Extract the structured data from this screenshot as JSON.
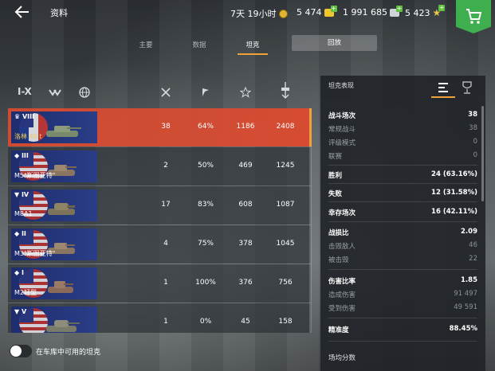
{
  "header": {
    "title": "资料",
    "premium_time": "7天 19小时",
    "gold": "5 474",
    "credits": "1 991 685",
    "free_xp": "5 423"
  },
  "tabs": [
    {
      "label": "主要",
      "active": false
    },
    {
      "label": "数据",
      "active": false
    },
    {
      "label": "坦克",
      "active": true
    },
    {
      "label": "回放",
      "active": false
    }
  ],
  "filters": {
    "tier_filter": "I-X",
    "type_icon": "tank-type-filter-icon",
    "nation_icon": "globe-icon"
  },
  "columns": [
    "battles-icon",
    "winrate-icon",
    "mastery-icon",
    "sort-icon"
  ],
  "tanks": [
    {
      "tier": "VIII",
      "name": "洛林 40 t",
      "premium": true,
      "battles": "38",
      "win": "64%",
      "xp": "1186",
      "dmg": "2408"
    },
    {
      "tier": "III",
      "name": "M5\"斯图亚特\"",
      "premium": false,
      "battles": "2",
      "win": "50%",
      "xp": "469",
      "dmg": "1245"
    },
    {
      "tier": "IV",
      "name": "M8A1",
      "premium": false,
      "battles": "17",
      "win": "83%",
      "xp": "608",
      "dmg": "1087"
    },
    {
      "tier": "II",
      "name": "M3\"斯图亚特\"",
      "premium": false,
      "battles": "4",
      "win": "75%",
      "xp": "378",
      "dmg": "1045"
    },
    {
      "tier": "I",
      "name": "M2轻型",
      "premium": false,
      "battles": "1",
      "win": "100%",
      "xp": "376",
      "dmg": "756"
    },
    {
      "tier": "V",
      "name": "",
      "premium": false,
      "battles": "1",
      "win": "0%",
      "xp": "45",
      "dmg": "158"
    }
  ],
  "toggle": {
    "label": "在车库中可用的坦克",
    "on": false
  },
  "panel": {
    "title": "坦克表现",
    "stats": [
      {
        "k": "战斗场次",
        "v": "38",
        "type": "main"
      },
      {
        "k": "常规战斗",
        "v": "38",
        "type": "sub"
      },
      {
        "k": "评级模式",
        "v": "0",
        "type": "sub"
      },
      {
        "k": "联赛",
        "v": "0",
        "type": "sub"
      },
      {
        "k": "胜利",
        "v": "24 (63.16%)",
        "type": "main"
      },
      {
        "k": "失败",
        "v": "12 (31.58%)",
        "type": "main"
      },
      {
        "k": "幸存场次",
        "v": "16 (42.11%)",
        "type": "main"
      },
      {
        "k": "战损比",
        "v": "2.09",
        "type": "main"
      },
      {
        "k": "击毁敌人",
        "v": "46",
        "type": "sub"
      },
      {
        "k": "被击毁",
        "v": "22",
        "type": "sub"
      },
      {
        "k": "伤害比率",
        "v": "1.85",
        "type": "main"
      },
      {
        "k": "造成伤害",
        "v": "91 497",
        "type": "sub"
      },
      {
        "k": "受到伤害",
        "v": "49 591",
        "type": "sub"
      },
      {
        "k": "精准度",
        "v": "88.45%",
        "type": "main"
      },
      {
        "k": "场均分数",
        "v": "",
        "type": "sub"
      }
    ]
  }
}
